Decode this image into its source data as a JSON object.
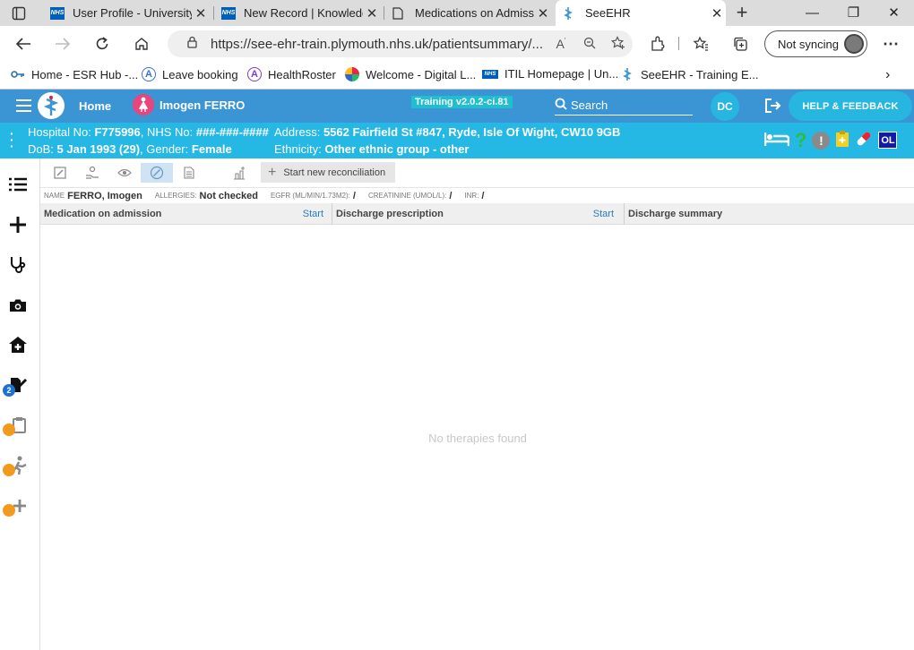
{
  "browser": {
    "tabs": [
      {
        "title": "User Profile - University",
        "icon": "nhs-icon"
      },
      {
        "title": "New Record | Knowledg",
        "icon": "nhs-icon"
      },
      {
        "title": "Medications on Admiss",
        "icon": "page-icon"
      },
      {
        "title": "SeeEHR",
        "icon": "seeehr-icon",
        "active": true
      }
    ],
    "new_tab": "+",
    "url": "https://see-ehr-train.plymouth.nhs.uk/patientsummary/...",
    "sync_label": "Not syncing"
  },
  "bookmarks": [
    {
      "label": "Home - ESR Hub -...",
      "icon": "key-icon"
    },
    {
      "label": "Leave booking",
      "icon": "letter-a-icon"
    },
    {
      "label": "HealthRoster",
      "icon": "letter-a-icon"
    },
    {
      "label": "Welcome - Digital L...",
      "icon": "globe-icon"
    },
    {
      "label": "ITIL Homepage | Un...",
      "icon": "nhs-icon"
    },
    {
      "label": "SeeEHR - Training E...",
      "icon": "seeehr-icon"
    }
  ],
  "app": {
    "home_label": "Home",
    "patient_name": "Imogen FERRO",
    "training_badge": "Training v2.0.2-ci.81",
    "search_label": "Search",
    "user_initials": "DC",
    "help_label": "HELP & FEEDBACK"
  },
  "patient": {
    "hospital_no_label": "Hospital No:",
    "hospital_no": "F775996",
    "nhs_no_label": ", NHS No:",
    "nhs_no": "###-###-####",
    "address_label": "Address:",
    "address": "5562 Fairfield St #847, Ryde, Isle Of Wight, CW10 9GB",
    "dob_label": "DoB:",
    "dob": "5 Jan 1993 (29)",
    "gender_label": ", Gender:",
    "gender": "Female",
    "ethnicity_label": "Ethnicity:",
    "ethnicity": "Other ethnic group - other",
    "ol_badge": "OL"
  },
  "sidebar": {
    "notes_count": "2"
  },
  "toolbar": {
    "start_reconciliation": "Start new reconciliation"
  },
  "info": {
    "name_label": "NAME",
    "name": "FERRO, Imogen",
    "allergies_label": "ALLERGIES:",
    "allergies": "Not checked",
    "egfr_label": "EGFR (ML/MIN/1.73M2):",
    "egfr": "/",
    "creatinine_label": "CREATININE (UMOL/L):",
    "creatinine": "/",
    "inr_label": "INR:",
    "inr": "/"
  },
  "columns": {
    "admission": "Medication on admission",
    "admission_start": "Start",
    "discharge": "Discharge prescription",
    "discharge_start": "Start",
    "summary": "Discharge summary"
  },
  "empty_message": "No therapies found"
}
